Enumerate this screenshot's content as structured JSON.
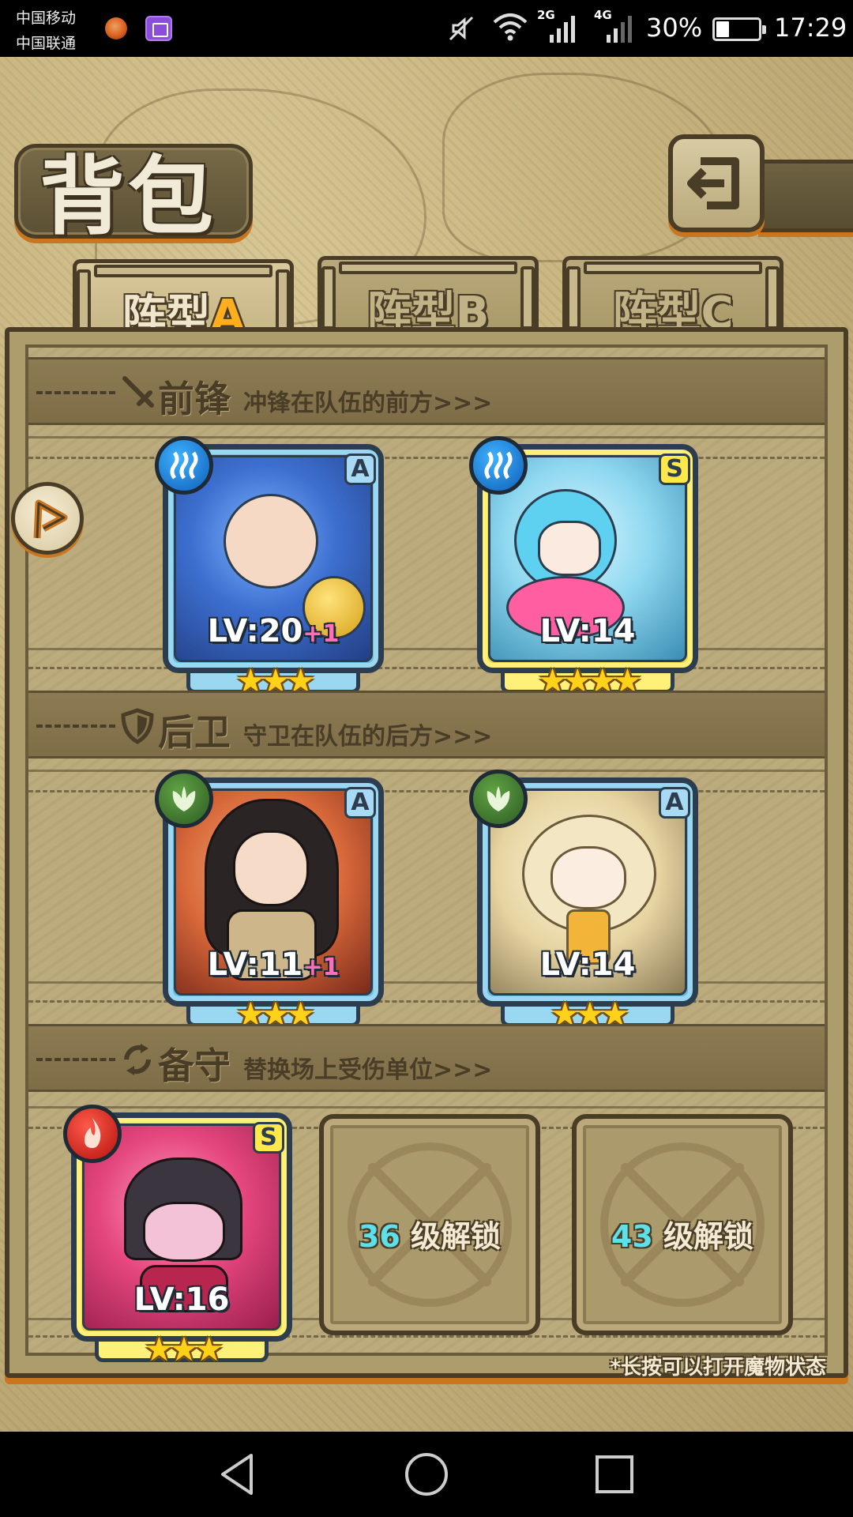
{
  "status_bar": {
    "carrier_1": "中国移动",
    "carrier_2": "中国联通",
    "net_1": "2G",
    "net_2": "4G",
    "battery": "30%",
    "battery_level": 0.3,
    "time": "17:29"
  },
  "header": {
    "title": "背包",
    "back_icon": "back-arrow-icon"
  },
  "tabs": [
    {
      "prefix": "阵型",
      "letter": "A",
      "active": true
    },
    {
      "prefix": "阵型",
      "letter": "B",
      "active": false
    },
    {
      "prefix": "阵型",
      "letter": "C",
      "active": false
    }
  ],
  "sections": {
    "vanguard": {
      "title": "前锋",
      "subtitle": "冲锋在队伍的前方>>>",
      "icon": "sword-icon"
    },
    "rearguard": {
      "title": "后卫",
      "subtitle": "守卫在队伍的后方>>>",
      "icon": "shield-icon"
    },
    "reserve": {
      "title": "备守",
      "subtitle": "替换场上受伤单位>>>",
      "icon": "swap-icon"
    }
  },
  "cards": {
    "vanguard": [
      {
        "rank": "A",
        "element": "water",
        "level": "LV:20",
        "bonus": "+1",
        "stars": 3,
        "stars_text": "★★★"
      },
      {
        "rank": "S",
        "element": "water",
        "level": "LV:14",
        "bonus": "",
        "stars": 4,
        "stars_text": "★★★★"
      }
    ],
    "rearguard": [
      {
        "rank": "A",
        "element": "leaf",
        "level": "LV:11",
        "bonus": "+1",
        "stars": 3,
        "stars_text": "★★★"
      },
      {
        "rank": "A",
        "element": "leaf",
        "level": "LV:14",
        "bonus": "",
        "stars": 3,
        "stars_text": "★★★"
      }
    ],
    "reserve": [
      {
        "rank": "S",
        "element": "fire",
        "level": "LV:16",
        "bonus": "",
        "stars": 3,
        "stars_text": "★★★"
      }
    ]
  },
  "locked_slots": [
    {
      "level": "36",
      "text": "级解锁"
    },
    {
      "level": "43",
      "text": "级解锁"
    }
  ],
  "hint": "*长按可以打开魔物状态",
  "colors": {
    "accent_orange": "#c9761e",
    "tab_active_letter": "#ffae1e",
    "lock_level": "#5ee0ea",
    "bonus_pink": "#ff6fb7"
  }
}
